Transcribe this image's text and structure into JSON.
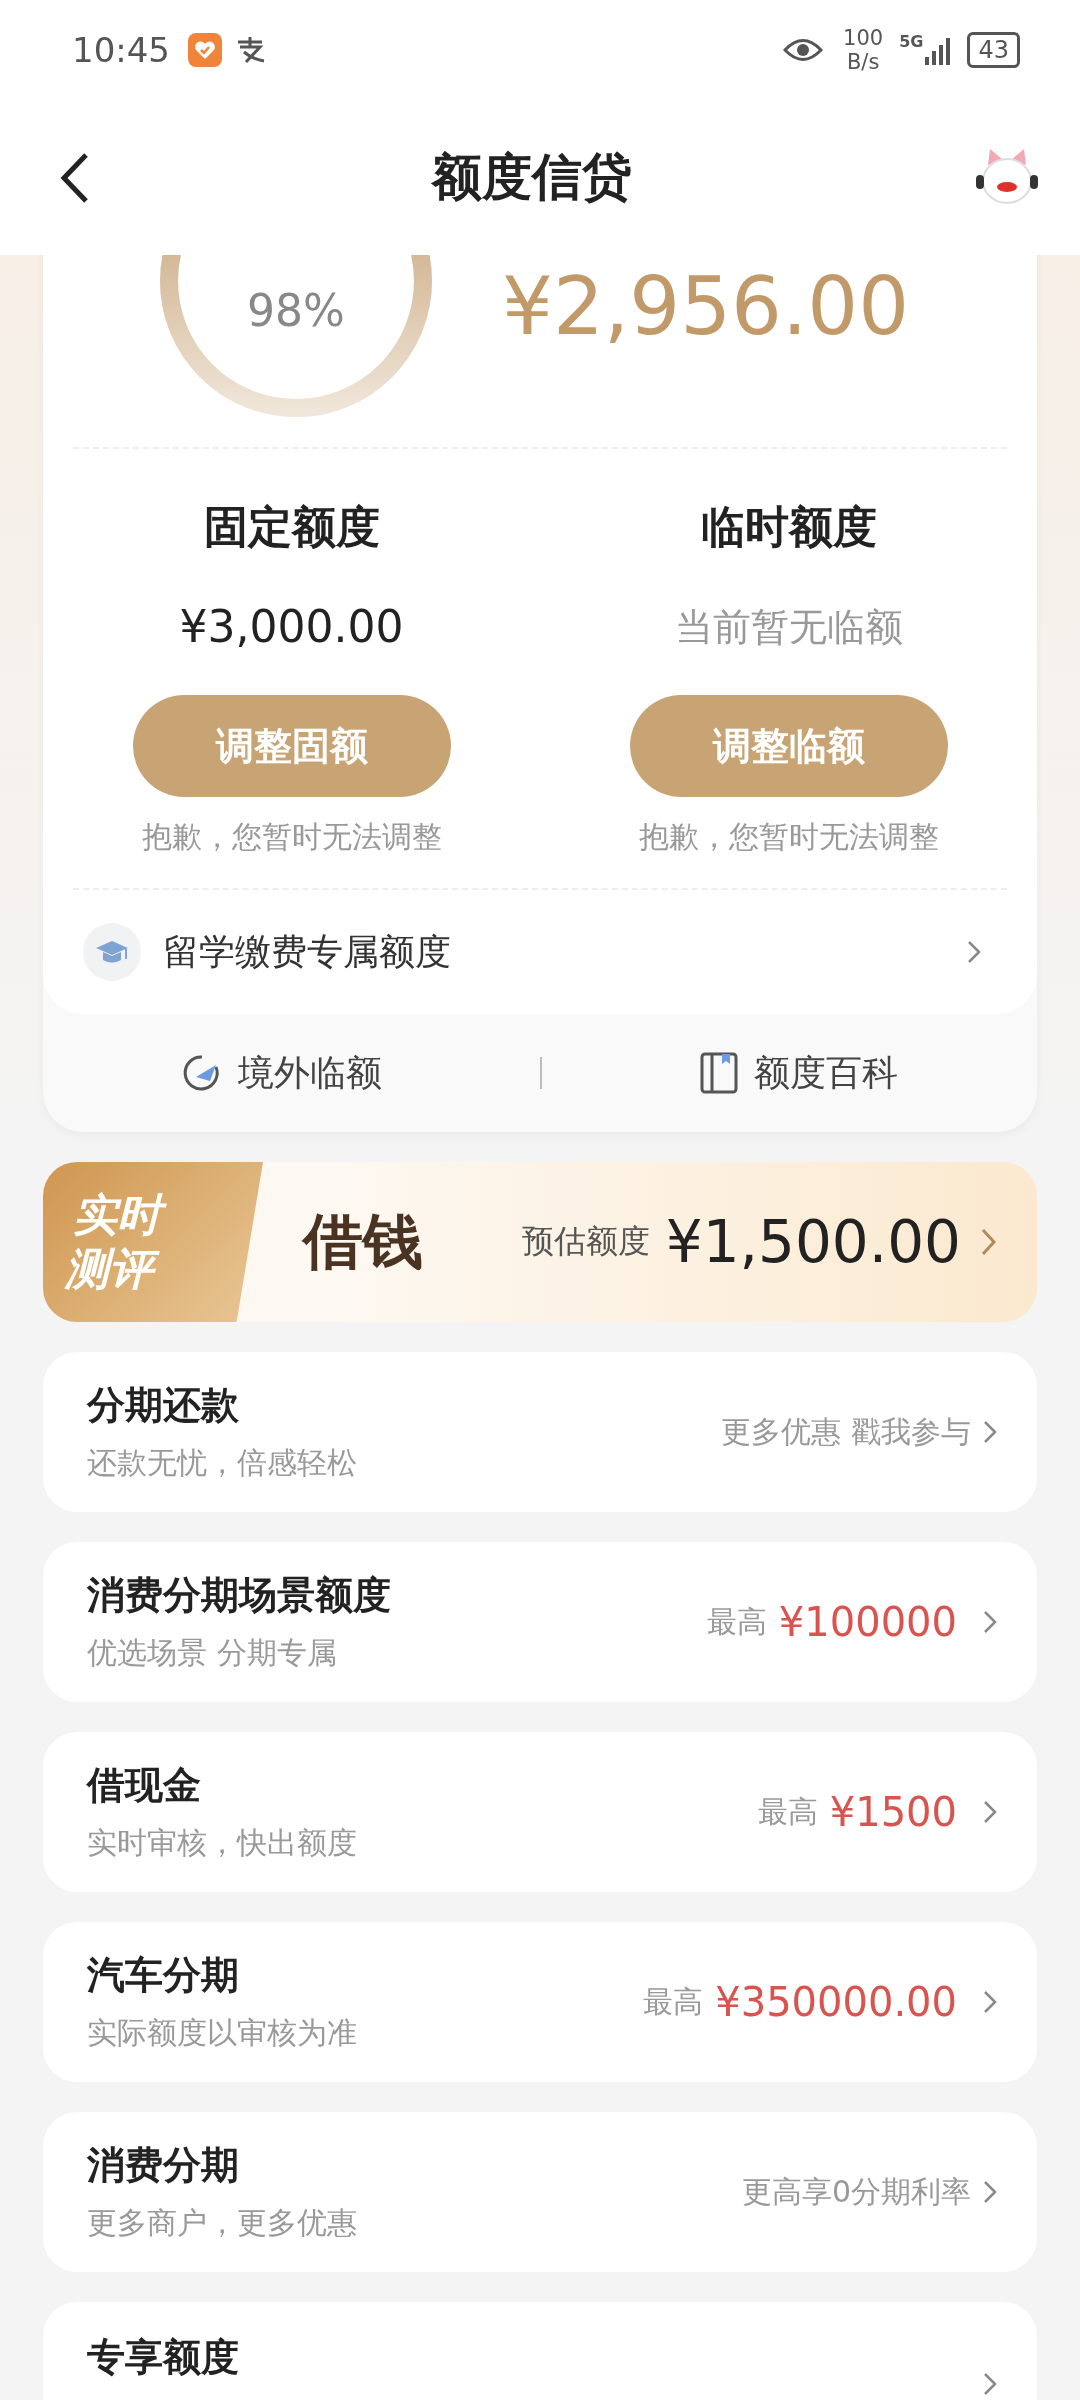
{
  "status_bar": {
    "time": "10:45",
    "net_speed": "100",
    "net_unit": "B/s",
    "network": "5G",
    "battery": "43"
  },
  "header": {
    "title": "额度信贷"
  },
  "credit": {
    "percent": "98%",
    "available": "¥2,956.00"
  },
  "quotas": [
    {
      "title": "固定额度",
      "amount": "¥3,000.00",
      "muted": false,
      "button": "调整固额",
      "note": "抱歉，您暂时无法调整"
    },
    {
      "title": "临时额度",
      "amount": "当前暂无临额",
      "muted": true,
      "button": "调整临额",
      "note": "抱歉，您暂时无法调整"
    }
  ],
  "study": {
    "label": "留学缴费专属额度"
  },
  "links": [
    {
      "kind": "plane",
      "label": "境外临额"
    },
    {
      "kind": "book",
      "label": "额度百科"
    }
  ],
  "banner": {
    "badge_lines": [
      "实时",
      "测评"
    ],
    "title": "借钱",
    "label": "预估额度",
    "amount": "¥1,500.00"
  },
  "products": [
    {
      "title": "分期还款",
      "subtitle": "还款无忧，倍感轻松",
      "note": "更多优惠 戳我参与"
    },
    {
      "title": "消费分期场景额度",
      "subtitle": "优选场景 分期专属",
      "note": "最高",
      "value": "¥100000"
    },
    {
      "title": "借现金",
      "subtitle": "实时审核，快出额度",
      "note": "最高",
      "value": "¥1500"
    },
    {
      "title": "汽车分期",
      "subtitle": "实际额度以审核为准",
      "note": "最高",
      "value": "¥350000.00"
    },
    {
      "title": "消费分期",
      "subtitle": "更多商户，更多优惠",
      "note": "更高享0分期利率"
    },
    {
      "title": "专享额度"
    }
  ]
}
